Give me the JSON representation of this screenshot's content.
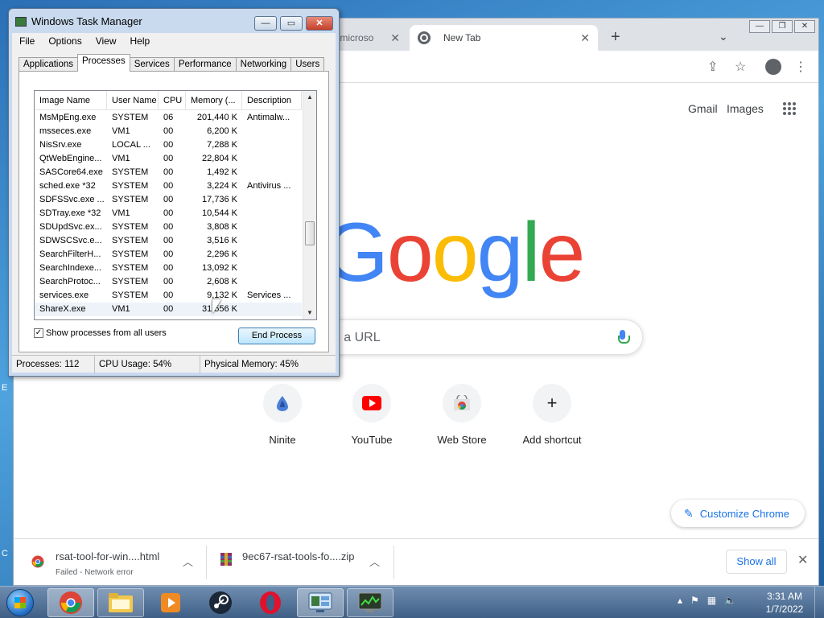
{
  "desktop": {
    "left_letters": [
      "E",
      "C",
      "7"
    ]
  },
  "chrome": {
    "tabs": [
      {
        "label": "cs.microso"
      },
      {
        "label": "New Tab",
        "active": true
      }
    ],
    "new_tab_symbol": "+",
    "top_links": [
      "Gmail",
      "Images"
    ],
    "logo_letters": [
      {
        "char": "G",
        "color": "#4285f4"
      },
      {
        "char": "o",
        "color": "#ea4335"
      },
      {
        "char": "o",
        "color": "#fbbc05"
      },
      {
        "char": "g",
        "color": "#4285f4"
      },
      {
        "char": "l",
        "color": "#34a853"
      },
      {
        "char": "e",
        "color": "#ea4335"
      }
    ],
    "search_placeholder": "ype a URL",
    "shortcuts": [
      {
        "label": "Ninite"
      },
      {
        "label": "YouTube"
      },
      {
        "label": "Web Store"
      },
      {
        "label": "Add shortcut",
        "symbol": "+"
      }
    ],
    "customize_label": "Customize Chrome",
    "downloads": [
      {
        "name": "rsat-tool-for-win....html",
        "status": "Failed - Network error"
      },
      {
        "name": "9ec67-rsat-tools-fo....zip",
        "status": ""
      }
    ],
    "show_all_label": "Show all"
  },
  "taskmgr": {
    "title": "Windows Task Manager",
    "menu": [
      "File",
      "Options",
      "View",
      "Help"
    ],
    "tabs": [
      "Applications",
      "Processes",
      "Services",
      "Performance",
      "Networking",
      "Users"
    ],
    "active_tab": "Processes",
    "columns": [
      "Image Name",
      "User Name",
      "CPU",
      "Memory (...",
      "Description"
    ],
    "rows": [
      [
        "MsMpEng.exe",
        "SYSTEM",
        "06",
        "201,440 K",
        "Antimalw..."
      ],
      [
        "msseces.exe",
        "VM1",
        "00",
        "6,200 K",
        ""
      ],
      [
        "NisSrv.exe",
        "LOCAL ...",
        "00",
        "7,288 K",
        ""
      ],
      [
        "QtWebEngine...",
        "VM1",
        "00",
        "22,804 K",
        ""
      ],
      [
        "SASCore64.exe",
        "SYSTEM",
        "00",
        "1,492 K",
        ""
      ],
      [
        "sched.exe *32",
        "SYSTEM",
        "00",
        "3,224 K",
        "Antivirus ..."
      ],
      [
        "SDFSSvc.exe ...",
        "SYSTEM",
        "00",
        "17,736 K",
        ""
      ],
      [
        "SDTray.exe *32",
        "VM1",
        "00",
        "10,544 K",
        ""
      ],
      [
        "SDUpdSvc.ex...",
        "SYSTEM",
        "00",
        "3,808 K",
        ""
      ],
      [
        "SDWSCSvc.e...",
        "SYSTEM",
        "00",
        "3,516 K",
        ""
      ],
      [
        "SearchFilterH...",
        "SYSTEM",
        "00",
        "2,296 K",
        ""
      ],
      [
        "SearchIndexe...",
        "SYSTEM",
        "00",
        "13,092 K",
        ""
      ],
      [
        "SearchProtoc...",
        "SYSTEM",
        "00",
        "2,608 K",
        ""
      ],
      [
        "services.exe",
        "SYSTEM",
        "00",
        "9,132 K",
        "Services ..."
      ],
      [
        "ShareX.exe",
        "VM1",
        "00",
        "31,556 K",
        ""
      ]
    ],
    "show_all_users_label": "Show processes from all users",
    "show_all_users_checked": true,
    "end_process_label": "End Process",
    "status": {
      "processes": "Processes: 112",
      "cpu": "CPU Usage: 54%",
      "memory": "Physical Memory: 45%"
    }
  },
  "taskbar": {
    "apps": [
      "chrome-icon",
      "explorer-icon",
      "media-player-icon",
      "steam-icon",
      "opera-icon",
      "taskmgr-icon",
      "terminal-icon"
    ],
    "time": "3:31 AM",
    "date": "1/7/2022"
  }
}
